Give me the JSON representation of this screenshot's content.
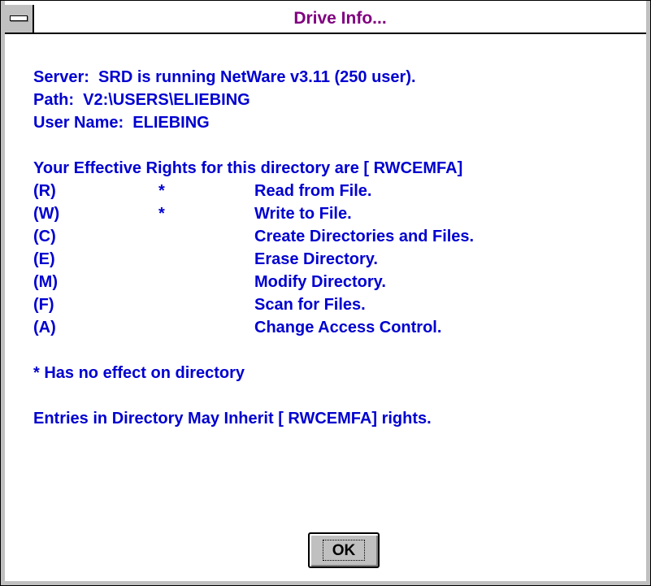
{
  "window": {
    "title": "Drive Info...",
    "title_color": "#800080",
    "text_color": "#0000d0"
  },
  "info": {
    "server_line": "Server:  SRD is running NetWare v3.11 (250 user).",
    "path_line": "Path:  V2:\\USERS\\ELIEBING",
    "user_line": "User Name:  ELIEBING"
  },
  "rights": {
    "header": "Your Effective Rights for this directory are [ RWCEMFA]",
    "items": [
      {
        "code": "(R)",
        "star": "*",
        "desc": "Read from File."
      },
      {
        "code": "(W)",
        "star": "*",
        "desc": "Write to File."
      },
      {
        "code": "(C)",
        "star": "",
        "desc": "Create Directories and Files."
      },
      {
        "code": "(E)",
        "star": "",
        "desc": "Erase Directory."
      },
      {
        "code": "(M)",
        "star": "",
        "desc": "Modify Directory."
      },
      {
        "code": "(F)",
        "star": "",
        "desc": "Scan for Files."
      },
      {
        "code": "(A)",
        "star": "",
        "desc": "Change Access Control."
      }
    ]
  },
  "note": "* Has no effect on directory",
  "inherit_line": "Entries in Directory May Inherit [ RWCEMFA] rights.",
  "buttons": {
    "ok_label": "OK"
  },
  "icons": {
    "system_menu": "system-menu-icon"
  }
}
